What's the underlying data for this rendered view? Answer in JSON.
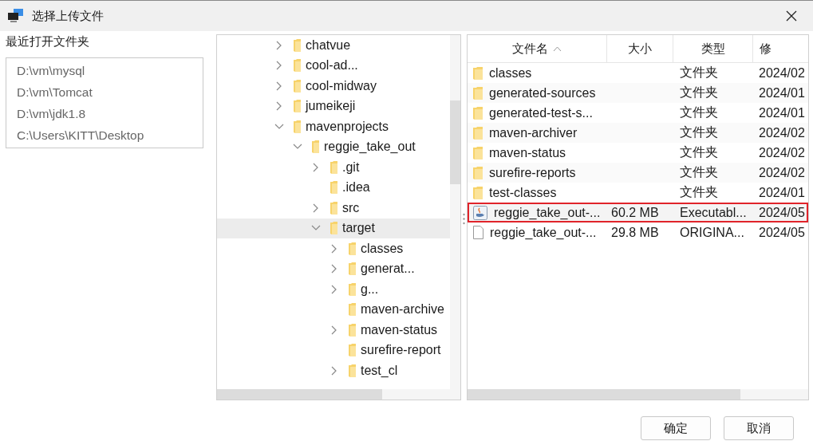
{
  "window": {
    "title": "选择上传文件"
  },
  "recent": {
    "label": "最近打开文件夹",
    "items": [
      "D:\\vm\\mysql",
      "D:\\vm\\Tomcat",
      "D:\\vm\\jdk1.8",
      "C:\\Users\\KITT\\Desktop"
    ]
  },
  "tree": [
    {
      "label": "chatvue",
      "expandable": true,
      "expanded": false,
      "selected": false
    },
    {
      "label": "cool-ad...",
      "expandable": true,
      "expanded": false,
      "selected": false
    },
    {
      "label": "cool-midway",
      "expandable": true,
      "expanded": false,
      "selected": false
    },
    {
      "label": "jumeikeji",
      "expandable": true,
      "expanded": false,
      "selected": false
    },
    {
      "label": "mavenprojects",
      "expandable": true,
      "expanded": true,
      "selected": false,
      "children": [
        {
          "label": "reggie_take_out",
          "expandable": true,
          "expanded": true,
          "selected": false,
          "children": [
            {
              "label": ".git",
              "expandable": true,
              "expanded": false,
              "selected": false
            },
            {
              "label": ".idea",
              "expandable": false,
              "selected": false
            },
            {
              "label": "src",
              "expandable": true,
              "expanded": false,
              "selected": false
            },
            {
              "label": "target",
              "expandable": true,
              "expanded": true,
              "selected": true,
              "children": [
                {
                  "label": "classes",
                  "expandable": true,
                  "expanded": false,
                  "selected": false
                },
                {
                  "label": "generat...",
                  "expandable": true,
                  "expanded": false,
                  "selected": false
                },
                {
                  "label": "g...",
                  "expandable": true,
                  "expanded": false,
                  "selected": false
                },
                {
                  "label": "maven-archive",
                  "expandable": false,
                  "selected": false
                },
                {
                  "label": "maven-status",
                  "expandable": true,
                  "expanded": false,
                  "selected": false
                },
                {
                  "label": "surefire-report",
                  "expandable": false,
                  "selected": false
                },
                {
                  "label": "test_cl",
                  "expandable": true,
                  "expanded": false,
                  "selected": false
                }
              ]
            }
          ]
        }
      ]
    }
  ],
  "table": {
    "columns": [
      {
        "label": "文件名",
        "sorted": true
      },
      {
        "label": "大小",
        "sorted": false
      },
      {
        "label": "类型",
        "sorted": false
      },
      {
        "label": "修",
        "sorted": false
      }
    ],
    "rows": [
      {
        "kind": "folder",
        "name": "classes",
        "type": "文件夹",
        "modified": "2024/02",
        "highlighted": false
      },
      {
        "kind": "folder",
        "name": "generated-sources",
        "type": "文件夹",
        "modified": "2024/01",
        "highlighted": false
      },
      {
        "kind": "folder",
        "name": "generated-test-s...",
        "type": "文件夹",
        "modified": "2024/01",
        "highlighted": false
      },
      {
        "kind": "folder",
        "name": "maven-archiver",
        "type": "文件夹",
        "modified": "2024/02",
        "highlighted": false
      },
      {
        "kind": "folder",
        "name": "maven-status",
        "type": "文件夹",
        "modified": "2024/02",
        "highlighted": false
      },
      {
        "kind": "folder",
        "name": "surefire-reports",
        "type": "文件夹",
        "modified": "2024/02",
        "highlighted": false
      },
      {
        "kind": "folder",
        "name": "test-classes",
        "type": "文件夹",
        "modified": "2024/01",
        "highlighted": false
      },
      {
        "kind": "jar",
        "name": "reggie_take_out-...",
        "size": "60.2 MB",
        "type": "Executabl...",
        "modified": "2024/05",
        "highlighted": true
      },
      {
        "kind": "file",
        "name": "reggie_take_out-...",
        "size": "29.8 MB",
        "type": "ORIGINA...",
        "modified": "2024/05",
        "highlighted": false
      }
    ]
  },
  "buttons": [
    "确定",
    "取消"
  ]
}
